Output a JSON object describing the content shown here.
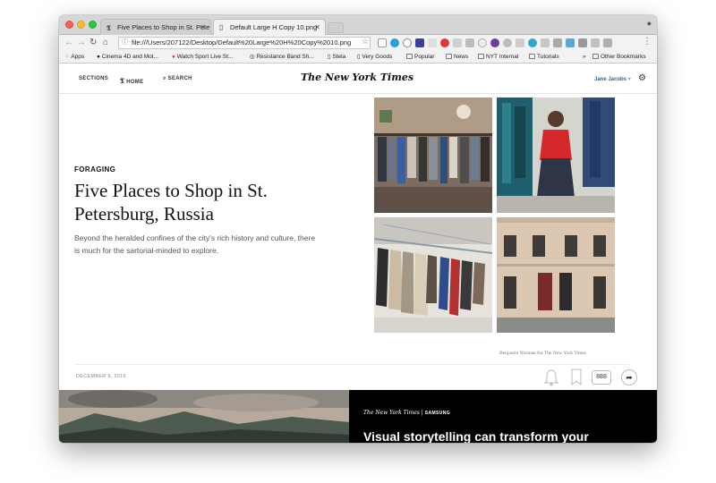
{
  "browser": {
    "tabs": [
      {
        "title": "Five Places to Shop in St. Pete",
        "icon": "nyt-t-icon"
      },
      {
        "title": "Default Large H Copy 10.png",
        "icon": "file-icon"
      }
    ],
    "address": "file:///Users/207122/Desktop/Default%20Large%20H%20Copy%2010.png",
    "bookmarks": [
      "Apps",
      "Cinema 4D and Mot...",
      "Watch Sport Live St...",
      "Resistance Band Sh...",
      "Stela",
      "Very Goods",
      "Popular",
      "News",
      "NYT Internal",
      "Tutorials"
    ],
    "other_bookmarks": "Other Bookmarks",
    "overflow": "»"
  },
  "masthead": {
    "sections": "SECTIONS",
    "home": "HOME",
    "search": "SEARCH",
    "logo": "The New York Times",
    "user": "Jane Jacobs"
  },
  "article": {
    "kicker": "FORAGING",
    "headline": "Five Places to Shop in St. Petersburg, Russia",
    "summary": "Beyond the heralded confines of the city's rich history and culture, there is much for the sartorial-minded to explore.",
    "photo_credit": "Benjamin Norman for The New York Times",
    "date": "DECEMBER 9, 2016",
    "comment_count": "888"
  },
  "promo": {
    "brand": "The New York Times",
    "partner": "SAMSUNG",
    "title": "Visual storytelling can transform your"
  },
  "colors": {
    "tab_bar": "#d6d6d6",
    "toolbar": "#f2f2f2",
    "user_link": "#326891",
    "promo_bg": "#000000"
  }
}
